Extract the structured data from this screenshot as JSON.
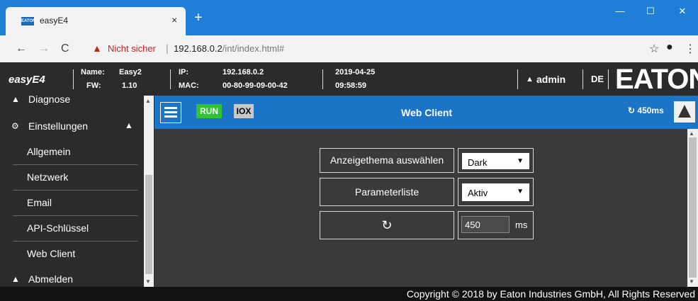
{
  "browser": {
    "tab_title": "easyE4",
    "favicon_text": "EATON",
    "close_glyph": "×",
    "new_tab_glyph": "+",
    "window_controls": [
      "—",
      "☐",
      "✕"
    ],
    "nav": {
      "back": "←",
      "forward": "→",
      "reload": "C"
    },
    "security_warning": "Nicht sicher",
    "url_host": "192.168.0.2",
    "url_path": "/int/index.html#",
    "icons": {
      "star": "☆",
      "profile": "●",
      "menu": "⋮"
    }
  },
  "app_header": {
    "brand": "easyE4",
    "name_label": "Name:",
    "name_value": "Easy2",
    "fw_label": "FW:",
    "fw_value": "1.10",
    "ip_label": "IP:",
    "ip_value": "192.168.0.2",
    "mac_label": "MAC:",
    "mac_value": "00-80-99-09-00-42",
    "date": "2019-04-25",
    "time": "09:58:59",
    "user": "admin",
    "language": "DE",
    "logo_text": "EATON"
  },
  "sidebar": {
    "diagnose": "Diagnose",
    "settings": "Einstellungen",
    "items": [
      "Allgemein",
      "Netzwerk",
      "Email",
      "API-Schlüssel",
      "Web Client"
    ],
    "logout": "Abmelden"
  },
  "toolbar": {
    "run": "RUN",
    "iox": "IOX",
    "title": "Web Client",
    "refresh_interval": "450ms",
    "colors": {
      "run_green": "#30c530",
      "bar_blue": "#1c74c6"
    }
  },
  "settings_form": {
    "theme_label": "Anzeigethema auswählen",
    "theme_value": "Dark",
    "param_label": "Parameterliste",
    "param_value": "Aktiv",
    "refresh_value": "450",
    "refresh_unit": "ms"
  },
  "footer": {
    "copyright": "Copyright © 2018 by Eaton Industries GmbH, All Rights Reserved"
  }
}
